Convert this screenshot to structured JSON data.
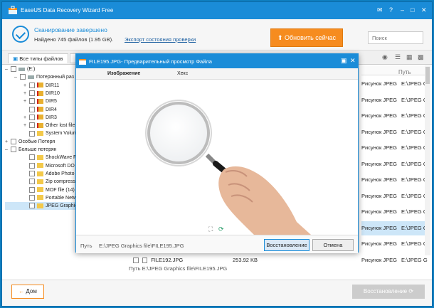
{
  "app": {
    "title": "EaseUS Data Recovery Wizard Free"
  },
  "header": {
    "status_title": "Сканирование завершено",
    "status_detail": "Найдено 745 файлов (1.95 GB).",
    "export_link": "Экспорт состояния проверки",
    "update_button": "Обновить сейчас",
    "search_placeholder": "Поиск"
  },
  "tabs": {
    "all_types": "Все типы файлов"
  },
  "tree": [
    {
      "label": "(E:)",
      "depth": 0,
      "expander": "–",
      "folder": "drive"
    },
    {
      "label": "Потерянный раз",
      "depth": 1,
      "expander": "–",
      "folder": "drive"
    },
    {
      "label": "DIR11",
      "depth": 2,
      "expander": "+",
      "folder": "red"
    },
    {
      "label": "DIR10",
      "depth": 2,
      "expander": "+",
      "folder": "red"
    },
    {
      "label": "DIR5",
      "depth": 2,
      "expander": "+",
      "folder": "red"
    },
    {
      "label": "DIR4",
      "depth": 2,
      "expander": "",
      "folder": "red"
    },
    {
      "label": "DIR3",
      "depth": 2,
      "expander": "+",
      "folder": "red"
    },
    {
      "label": "Other lost file",
      "depth": 2,
      "expander": "+",
      "folder": "red"
    },
    {
      "label": "System Volum",
      "depth": 2,
      "expander": "",
      "folder": "plain"
    },
    {
      "label": "Особые Потеря",
      "depth": 0,
      "expander": "+",
      "folder": "none"
    },
    {
      "label": "Больше потерян",
      "depth": 0,
      "expander": "–",
      "folder": "none"
    },
    {
      "label": "ShockWave F",
      "depth": 2,
      "expander": "",
      "folder": "plain"
    },
    {
      "label": "Microsoft DO",
      "depth": 2,
      "expander": "",
      "folder": "plain"
    },
    {
      "label": "Adobe Photo",
      "depth": 2,
      "expander": "",
      "folder": "plain"
    },
    {
      "label": "Zip compress",
      "depth": 2,
      "expander": "",
      "folder": "plain"
    },
    {
      "label": "MOF file (14)",
      "depth": 2,
      "expander": "",
      "folder": "plain"
    },
    {
      "label": "Portable Netw",
      "depth": 2,
      "expander": "",
      "folder": "plain"
    },
    {
      "label": "JPEG Graphics",
      "depth": 2,
      "expander": "",
      "folder": "plain",
      "selected": true
    }
  ],
  "list": {
    "path_header": "Путь",
    "rows": [
      {
        "type": "Рисунок JPEG",
        "path": "E:\\JPEG G"
      },
      {
        "type": "Рисунок JPEG",
        "path": "E:\\JPEG G"
      },
      {
        "type": "Рисунок JPEG",
        "path": "E:\\JPEG G"
      },
      {
        "type": "Рисунок JPEG",
        "path": "E:\\JPEG G"
      },
      {
        "type": "Рисунок JPEG",
        "path": "E:\\JPEG G"
      },
      {
        "type": "Рисунок JPEG",
        "path": "E:\\JPEG G"
      },
      {
        "type": "Рисунок JPEG",
        "path": "E:\\JPEG G"
      },
      {
        "type": "Рисунок JPEG",
        "path": "E:\\JPEG G"
      },
      {
        "type": "Рисунок JPEG",
        "path": "E:\\JPEG G"
      },
      {
        "type": "Рисунок JPEG",
        "path": "E:\\JPEG G",
        "selected": true
      },
      {
        "type": "Рисунок JPEG",
        "path": "E:\\JPEG G"
      },
      {
        "type": "Рисунок JPEG",
        "path": "E:\\JPEG G"
      }
    ],
    "bottom_row": {
      "name": "FILE192.JPG",
      "size": "253.92 KB",
      "type": "Рисунок JPEG",
      "path": "E:\\JPEG G"
    }
  },
  "pathbar": "Путь    E:\\JPEG Graphics file\\FILE195.JPG",
  "footer": {
    "home_button": "Дом",
    "restore_button": "Восстановление"
  },
  "dialog": {
    "title": "FILE195.JPG- Предварительный просмотр Файла",
    "tab_image": "Изображение",
    "tab_hex": "Хекс",
    "path_label": "Путь",
    "path_value": "E:\\JPEG Graphics file\\FILE195.JPG",
    "restore_button": "Восстановление",
    "cancel_button": "Отмена"
  },
  "colors": {
    "accent": "#1a8cd8",
    "orange": "#f68c1f"
  }
}
